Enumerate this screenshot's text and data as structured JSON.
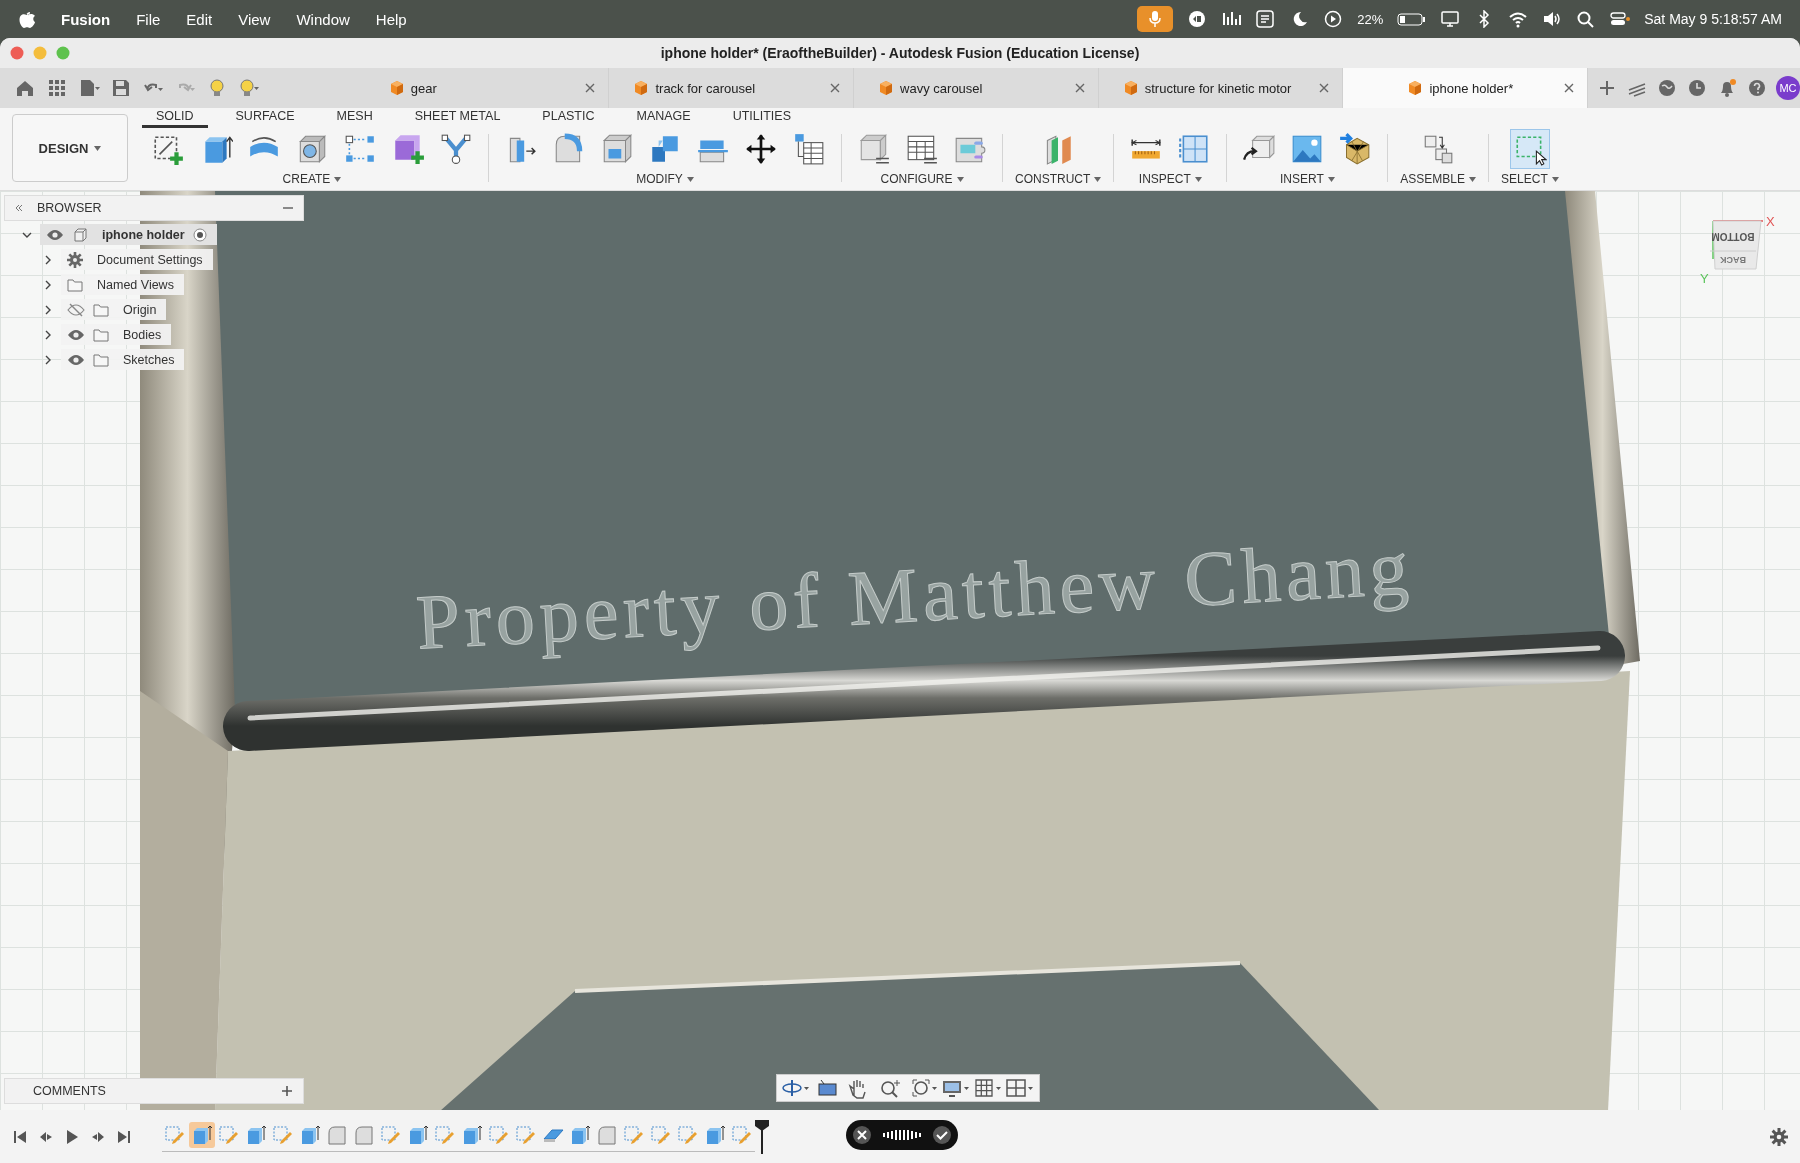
{
  "menubar": {
    "app": "Fusion",
    "menus": [
      "File",
      "Edit",
      "View",
      "Window",
      "Help"
    ],
    "battery": "22%",
    "clock": "Sat May 9 5:18:57 AM"
  },
  "window": {
    "title": "iphone holder* (EraoftheBuilder) - Autodesk Fusion (Education License)"
  },
  "doc_tabs": [
    {
      "label": "gear",
      "selected": false
    },
    {
      "label": "track for carousel",
      "selected": false
    },
    {
      "label": "wavy carousel",
      "selected": false
    },
    {
      "label": "structure for kinetic motor",
      "selected": false
    },
    {
      "label": "iphone holder*",
      "selected": true
    }
  ],
  "account": "MC",
  "workspace": "DESIGN",
  "ribbon_tabs": [
    {
      "label": "SOLID",
      "selected": true
    },
    {
      "label": "SURFACE",
      "selected": false
    },
    {
      "label": "MESH",
      "selected": false
    },
    {
      "label": "SHEET METAL",
      "selected": false
    },
    {
      "label": "PLASTIC",
      "selected": false
    },
    {
      "label": "MANAGE",
      "selected": false
    },
    {
      "label": "UTILITIES",
      "selected": false
    }
  ],
  "tool_groups": [
    {
      "label": "CREATE",
      "active": false
    },
    {
      "label": "MODIFY",
      "active": false
    },
    {
      "label": "CONFIGURE",
      "active": false
    },
    {
      "label": "CONSTRUCT",
      "active": false
    },
    {
      "label": "INSPECT",
      "active": false
    },
    {
      "label": "INSERT",
      "active": false
    },
    {
      "label": "ASSEMBLE",
      "active": false
    },
    {
      "label": "SELECT",
      "active": true
    }
  ],
  "browser": {
    "title": "BROWSER",
    "tree": {
      "label": "iphone holder",
      "kind": "component",
      "visible": true,
      "expanded": true,
      "children": [
        {
          "label": "Document Settings",
          "kind": "settings",
          "expanded": false
        },
        {
          "label": "Named Views",
          "kind": "folder",
          "expanded": false
        },
        {
          "label": "Origin",
          "kind": "folder",
          "visible": false,
          "expanded": false
        },
        {
          "label": "Bodies",
          "kind": "folder",
          "visible": true,
          "expanded": false
        },
        {
          "label": "Sketches",
          "kind": "folder",
          "visible": true,
          "expanded": false
        }
      ]
    }
  },
  "viewport": {
    "engraved_text": "Property of Matthew Chang",
    "viewcube": {
      "top_face": "BOTTOM",
      "front_face": "BACK",
      "x_axis": "X",
      "y_axis": "Y"
    }
  },
  "comments": {
    "title": "COMMENTS"
  },
  "timeline": [
    {
      "kind": "sketch",
      "selected": false
    },
    {
      "kind": "extrude",
      "selected": true
    },
    {
      "kind": "sketch",
      "selected": false
    },
    {
      "kind": "extrude",
      "selected": false
    },
    {
      "kind": "sketch",
      "selected": false
    },
    {
      "kind": "extrude",
      "selected": false
    },
    {
      "kind": "fillet",
      "selected": false
    },
    {
      "kind": "fillet",
      "selected": false
    },
    {
      "kind": "sketch",
      "selected": false
    },
    {
      "kind": "extrude",
      "selected": false
    },
    {
      "kind": "sketch",
      "selected": false
    },
    {
      "kind": "extrude",
      "selected": false
    },
    {
      "kind": "sketch",
      "selected": false
    },
    {
      "kind": "sketch",
      "selected": false
    },
    {
      "kind": "plane",
      "selected": false
    },
    {
      "kind": "extrude",
      "selected": false
    },
    {
      "kind": "fillet",
      "selected": false
    },
    {
      "kind": "sketch",
      "selected": false
    },
    {
      "kind": "sketch",
      "selected": false
    },
    {
      "kind": "sketch",
      "selected": false
    },
    {
      "kind": "extrude",
      "selected": false
    },
    {
      "kind": "sketch",
      "selected": false
    }
  ]
}
